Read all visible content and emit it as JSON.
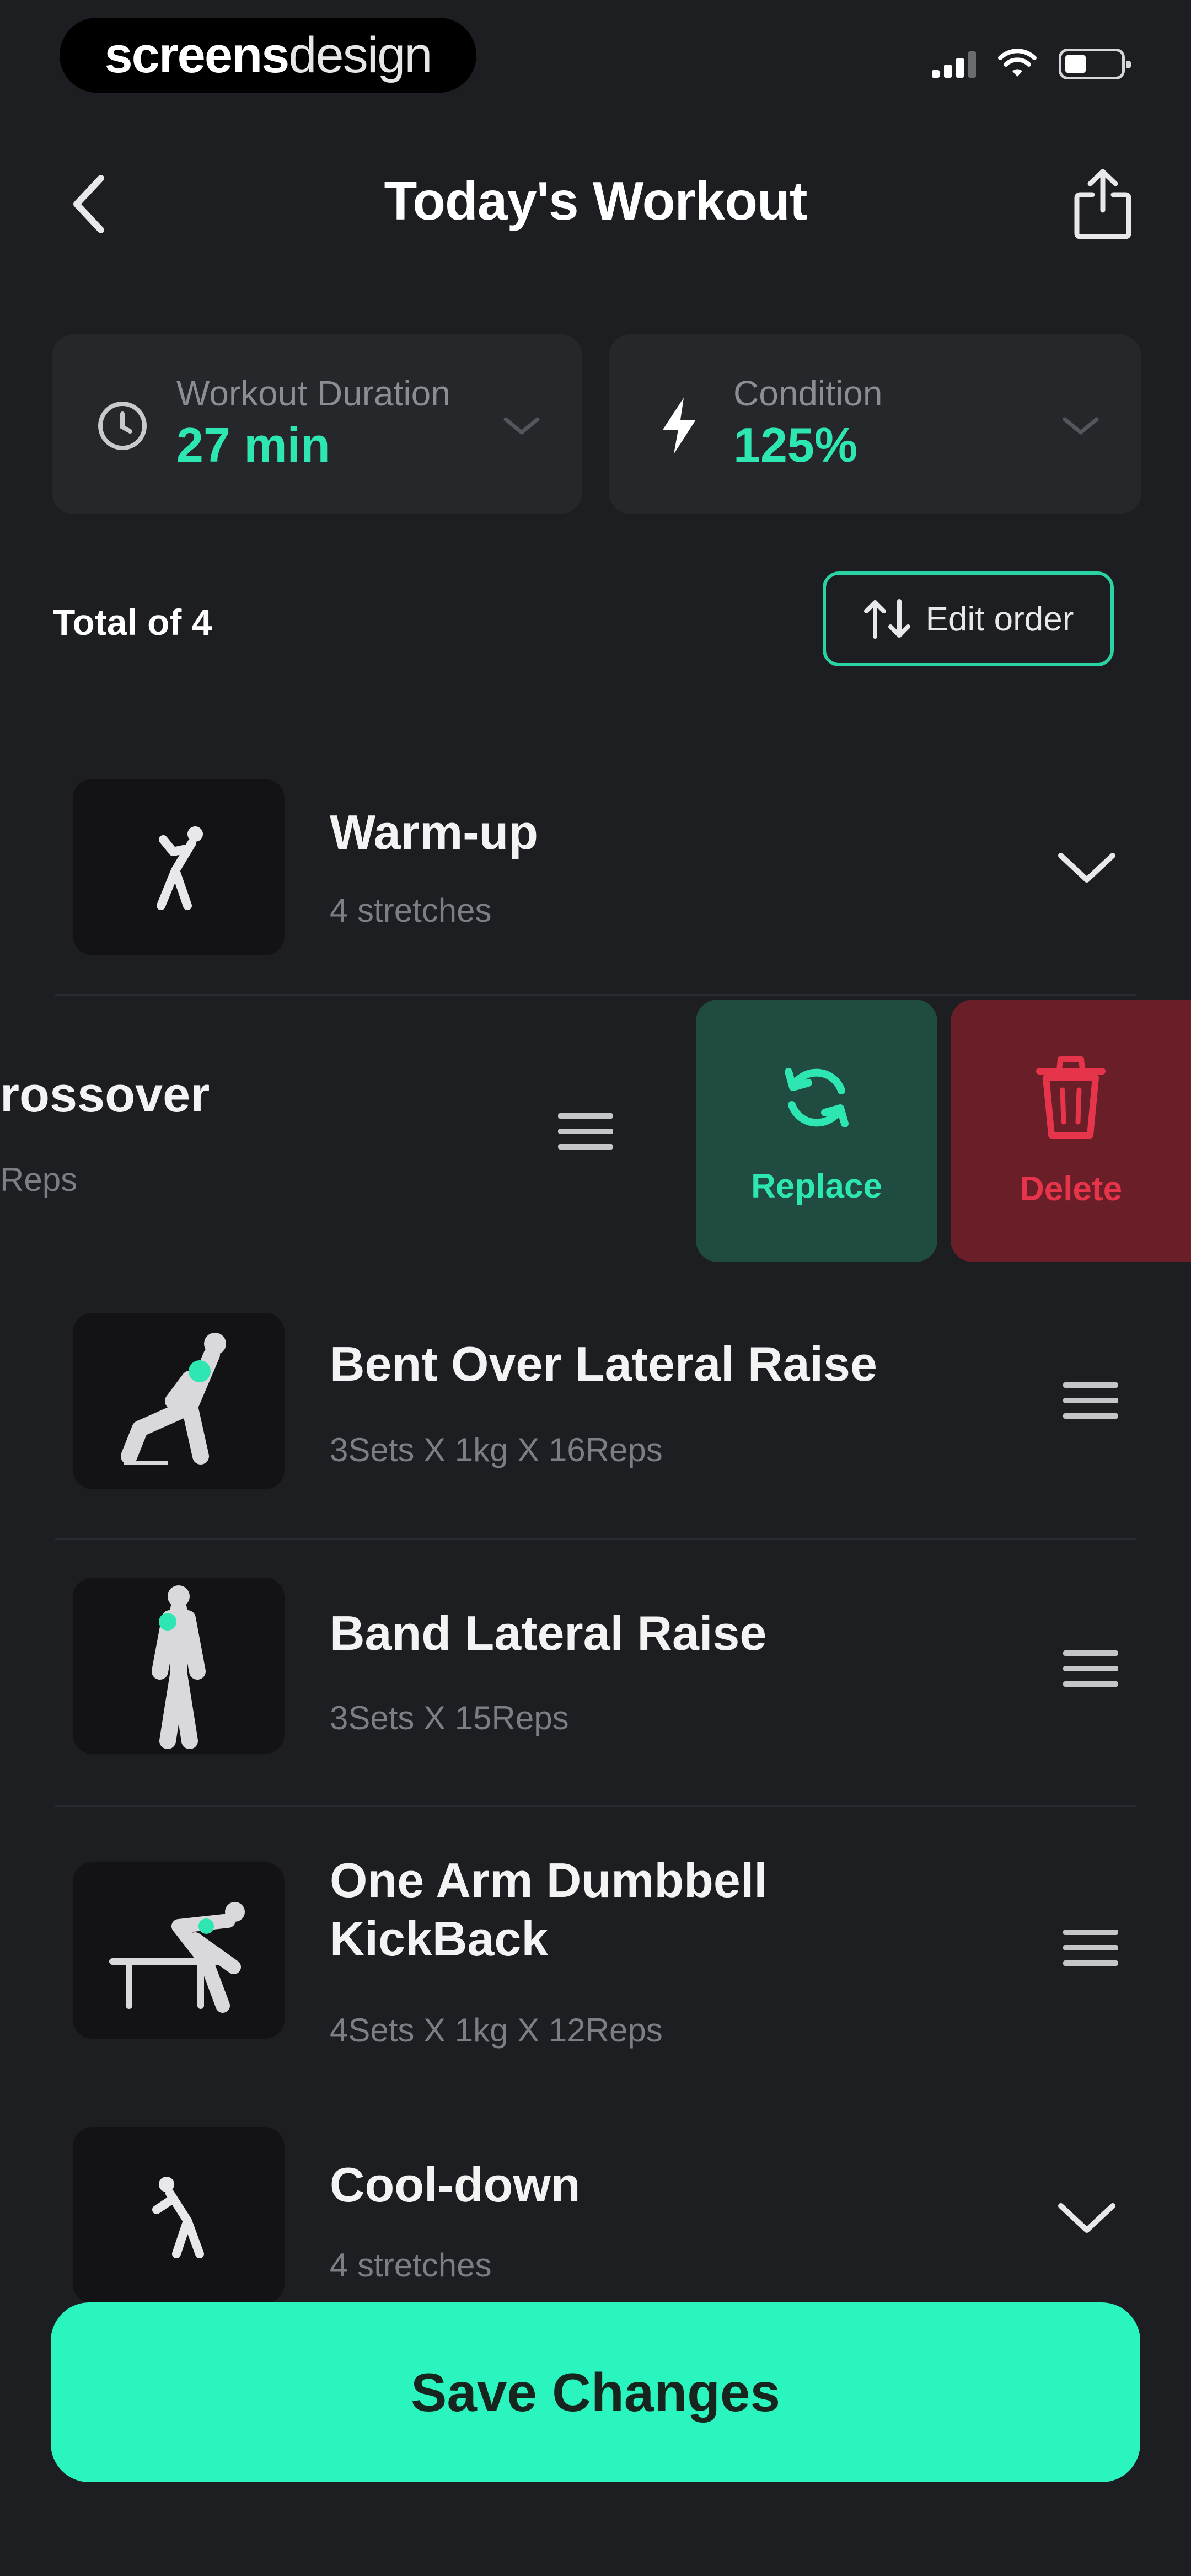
{
  "status_bar": {
    "brand_bold": "screens",
    "brand_light": "design"
  },
  "header": {
    "title": "Today's Workout"
  },
  "stats": {
    "duration": {
      "label": "Workout Duration",
      "value": "27 min"
    },
    "condition": {
      "label": "Condition",
      "value": "125%"
    }
  },
  "list_meta": {
    "total": "Total of 4",
    "edit_order_label": "Edit order"
  },
  "warmup": {
    "title": "Warm-up",
    "subtitle": "4 stretches"
  },
  "swiped_item": {
    "title": "rossover",
    "subtitle": "Reps"
  },
  "swipe_actions": {
    "replace_label": "Replace",
    "delete_label": "Delete"
  },
  "exercises": [
    {
      "title": "Bent Over Lateral Raise",
      "subtitle": "3Sets X 1kg X 16Reps"
    },
    {
      "title": "Band Lateral Raise",
      "subtitle": "3Sets X 15Reps"
    },
    {
      "title_line1": "One Arm Dumbbell",
      "title_line2": "KickBack",
      "subtitle": "4Sets X 1kg X 12Reps"
    }
  ],
  "cooldown": {
    "title": "Cool-down",
    "subtitle": "4 stretches"
  },
  "footer": {
    "save_label": "Save Changes"
  },
  "colors": {
    "accent": "#2bf5bf",
    "background": "#1d1e22",
    "card": "#26272b",
    "delete": "#6a1e28",
    "replace": "#1f4b40"
  },
  "icons": [
    "back-chevron-icon",
    "share-icon",
    "clock-icon",
    "lightning-icon",
    "chevron-down-icon",
    "sort-icon",
    "refresh-icon",
    "trash-icon",
    "drag-handle-icon"
  ]
}
